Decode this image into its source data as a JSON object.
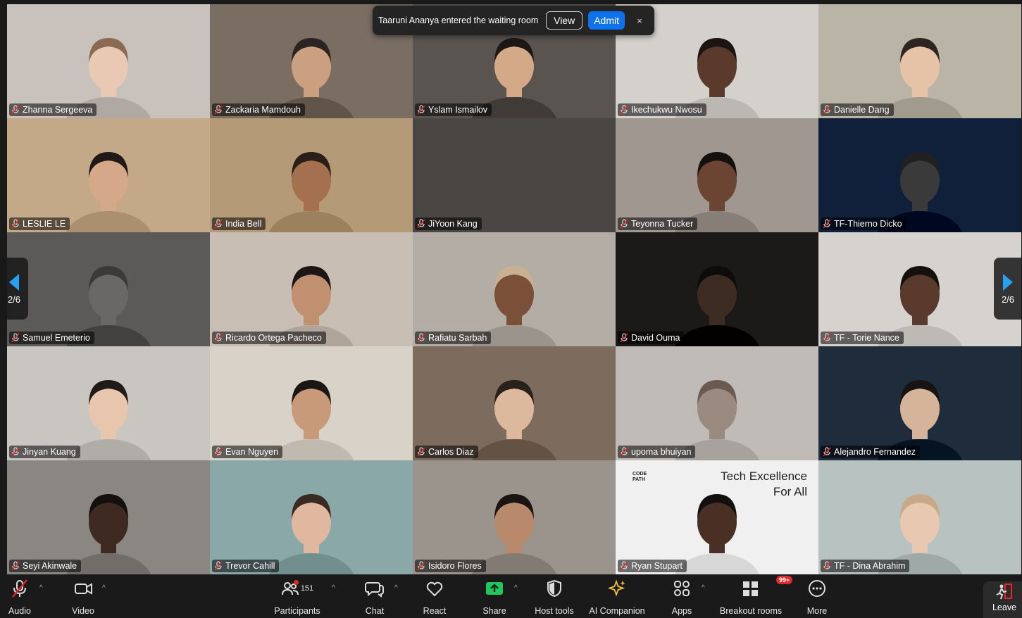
{
  "notification": {
    "message": "Taaruni Ananya entered the waiting room",
    "view_label": "View",
    "admit_label": "Admit",
    "close_label": "×"
  },
  "pager": {
    "left": "2/6",
    "right": "2/6"
  },
  "participants_grid": [
    {
      "name": "Zhanna Sergeeva",
      "bg": "#c9c2bc",
      "skin": "#e9c9b4",
      "hair": "#8a6a52"
    },
    {
      "name": "Zackaria Mamdouh",
      "bg": "#7a6e63",
      "skin": "#caa080",
      "hair": "#2b2422"
    },
    {
      "name": "Yslam Ismailov",
      "bg": "#5a5450",
      "skin": "#d4a988",
      "hair": "#1d1816"
    },
    {
      "name": "Ikechukwu Nwosu",
      "bg": "#d4d0cc",
      "skin": "#5a3a2a",
      "hair": "#1b1412"
    },
    {
      "name": "Danielle Dang",
      "bg": "#b9b4a6",
      "skin": "#e6c2a6",
      "hair": "#2e2420"
    },
    {
      "name": "LESLIE LE",
      "bg": "#c4a988",
      "skin": "#d4a888",
      "hair": "#1f1a18"
    },
    {
      "name": "India Bell",
      "bg": "#b59a78",
      "skin": "#a57050",
      "hair": "#2a1e18"
    },
    {
      "name": "JiYoon Kang",
      "bg": "#4a4644",
      "skin": "#4a4644",
      "hair": "#4a4644"
    },
    {
      "name": "Teyonna Tucker",
      "bg": "#a09790",
      "skin": "#6b4432",
      "hair": "#151010"
    },
    {
      "name": "TF-Thierno Dicko",
      "bg": "#10203a",
      "skin": "#3a3a3a",
      "hair": "#202020"
    },
    {
      "name": "Samuel Emeterio",
      "bg": "#5b5a58",
      "skin": "#6a6866",
      "hair": "#3a3a3a"
    },
    {
      "name": "Ricardo Ortega Pacheco",
      "bg": "#c8beb4",
      "skin": "#c09070",
      "hair": "#1c1614"
    },
    {
      "name": "Rafiatu Sarbah",
      "bg": "#b3ada5",
      "skin": "#7a5038",
      "hair": "#c8b090"
    },
    {
      "name": "David Ouma",
      "bg": "#1c1a18",
      "skin": "#3c2c22",
      "hair": "#0e0c0a"
    },
    {
      "name": "TF - Torie Nance",
      "bg": "#d6d2ce",
      "skin": "#5a3a2c",
      "hair": "#14100e"
    },
    {
      "name": "Jinyan Kuang",
      "bg": "#c9c6c2",
      "skin": "#e8c6ae",
      "hair": "#201a18"
    },
    {
      "name": "Evan Nguyen",
      "bg": "#d8d2c8",
      "skin": "#c89a7a",
      "hair": "#1a1614"
    },
    {
      "name": "Carlos Diaz",
      "bg": "#7d6b5d",
      "skin": "#dcb89c",
      "hair": "#2a201c"
    },
    {
      "name": "upoma bhuiyan",
      "bg": "#c0bbb6",
      "skin": "#9a8a80",
      "hair": "#6a5a50"
    },
    {
      "name": "Alejandro Fernandez",
      "bg": "#1f2c3c",
      "skin": "#d6b49a",
      "hair": "#181412"
    },
    {
      "name": "Seyi Akinwale",
      "bg": "#8a8682",
      "skin": "#3e2a20",
      "hair": "#141010"
    },
    {
      "name": "Trevor Cahill",
      "bg": "#8aa8a8",
      "skin": "#e0b8a0",
      "hair": "#3a2a22"
    },
    {
      "name": "Isidoro Flores",
      "bg": "#9a948c",
      "skin": "#b8896a",
      "hair": "#1a1412"
    },
    {
      "name": "Ryan Stupart",
      "bg": "#f0f0f0",
      "skin": "#4a3024",
      "hair": "#141010"
    },
    {
      "name": "TF - Dina Abrahim",
      "bg": "#b8c2c0",
      "skin": "#e8c8b0",
      "hair": "#c8a888"
    }
  ],
  "banner": {
    "line1": "Tech Excellence",
    "line2": "For All",
    "logo": "CODE PATH"
  },
  "toolbar": {
    "audio": "Audio",
    "video": "Video",
    "participants": "Participants",
    "participants_count": "151",
    "chat": "Chat",
    "react": "React",
    "share": "Share",
    "host_tools": "Host tools",
    "ai_companion": "AI Companion",
    "apps": "Apps",
    "breakout_rooms": "Breakout rooms",
    "breakout_badge": "99+",
    "more": "More",
    "leave": "Leave"
  },
  "colors": {
    "accent": "#0e72ed",
    "share_green": "#22c55e",
    "muted_red": "#e02828",
    "ai_gold": "#f0c040"
  }
}
